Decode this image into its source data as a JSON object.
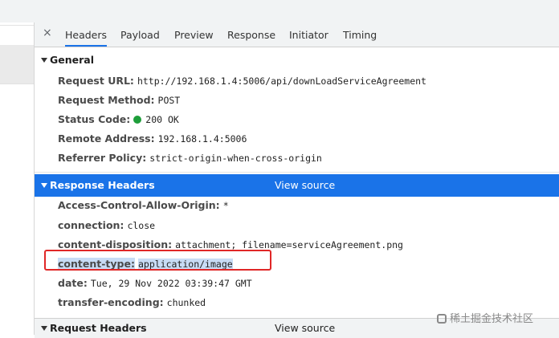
{
  "tabs": [
    "Headers",
    "Payload",
    "Preview",
    "Response",
    "Initiator",
    "Timing"
  ],
  "close_icon": "×",
  "general": {
    "title": "General",
    "rows": [
      {
        "key": "Request URL:",
        "value": "http://192.168.1.4:5006/api/downLoadServiceAgreement"
      },
      {
        "key": "Request Method:",
        "value": "POST"
      },
      {
        "key": "Status Code:",
        "value": "200 OK"
      },
      {
        "key": "Remote Address:",
        "value": "192.168.1.4:5006"
      },
      {
        "key": "Referrer Policy:",
        "value": "strict-origin-when-cross-origin"
      }
    ]
  },
  "response_headers": {
    "title": "Response Headers",
    "view_source": "View source",
    "rows": [
      {
        "key": "Access-Control-Allow-Origin:",
        "value": "*"
      },
      {
        "key": "connection:",
        "value": "close"
      },
      {
        "key": "content-disposition:",
        "value": "attachment; filename=serviceAgreement.png"
      },
      {
        "key": "content-type:",
        "value": "application/image"
      },
      {
        "key": "date:",
        "value": "Tue, 29 Nov 2022 03:39:47 GMT"
      },
      {
        "key": "transfer-encoding:",
        "value": "chunked"
      }
    ]
  },
  "request_headers": {
    "title": "Request Headers",
    "view_source": "View source"
  },
  "watermark": "稀土掘金技术社区",
  "colors": {
    "accent": "#1a73e8",
    "status_ok": "#1e9e3a",
    "highlight_box": "#e02727"
  }
}
